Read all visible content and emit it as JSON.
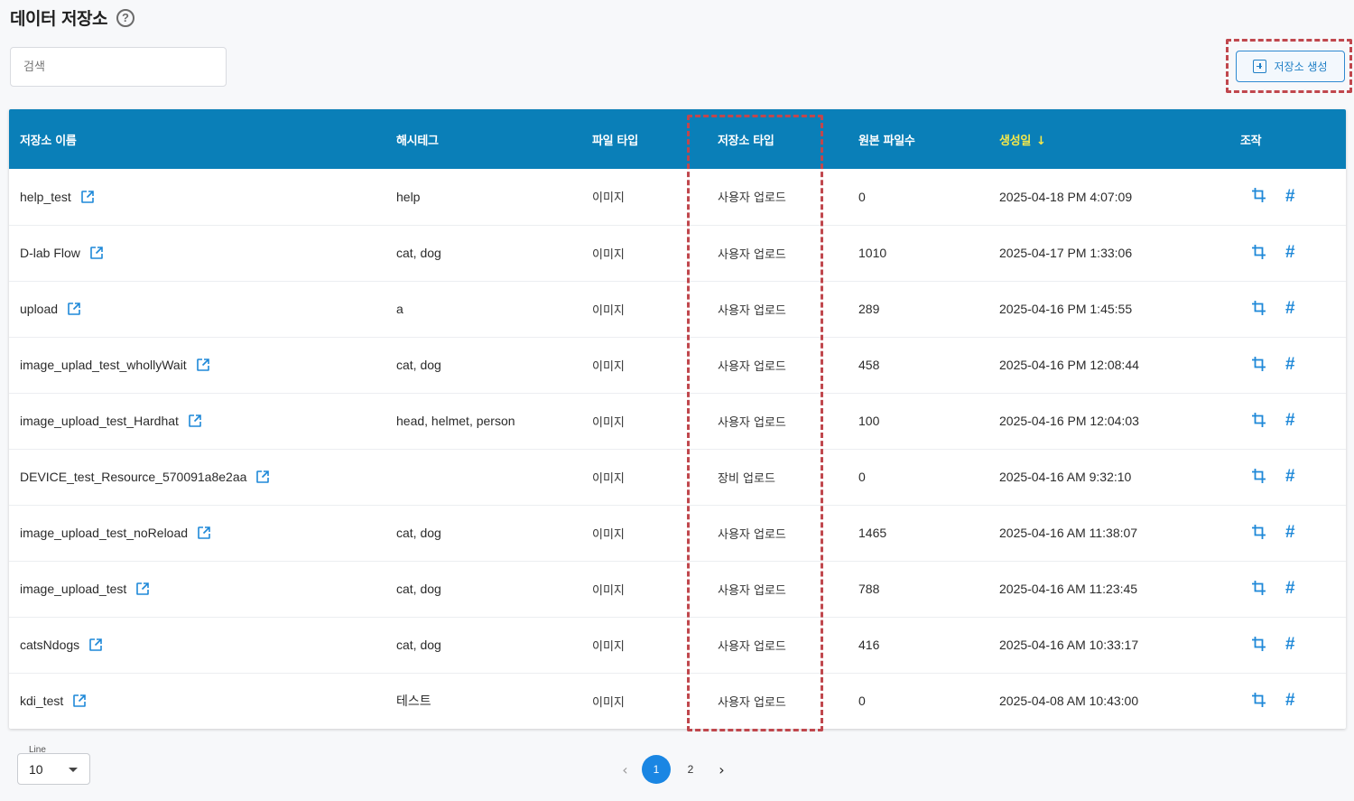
{
  "header": {
    "title": "데이터 저장소",
    "help_icon": "?"
  },
  "search": {
    "placeholder": "검색",
    "value": ""
  },
  "toolbar": {
    "create_label": "저장소 생성"
  },
  "table": {
    "columns": [
      "저장소 이름",
      "해시테그",
      "파일 타입",
      "저장소 타입",
      "원본 파일수",
      "생성일",
      "조작"
    ],
    "sort_indicator": "↓",
    "rows": [
      {
        "name": "help_test",
        "tags": "help",
        "file_type": "이미지",
        "storage_type": "사용자 업로드",
        "count": "0",
        "created": "2025-04-18 PM 4:07:09"
      },
      {
        "name": "D-lab Flow",
        "tags": "cat, dog",
        "file_type": "이미지",
        "storage_type": "사용자 업로드",
        "count": "1010",
        "created": "2025-04-17 PM 1:33:06"
      },
      {
        "name": "upload",
        "tags": "a",
        "file_type": "이미지",
        "storage_type": "사용자 업로드",
        "count": "289",
        "created": "2025-04-16 PM 1:45:55"
      },
      {
        "name": "image_uplad_test_whollyWait",
        "tags": "cat, dog",
        "file_type": "이미지",
        "storage_type": "사용자 업로드",
        "count": "458",
        "created": "2025-04-16 PM 12:08:44"
      },
      {
        "name": "image_upload_test_Hardhat",
        "tags": "head, helmet, person",
        "file_type": "이미지",
        "storage_type": "사용자 업로드",
        "count": "100",
        "created": "2025-04-16 PM 12:04:03"
      },
      {
        "name": "DEVICE_test_Resource_570091a8e2aa",
        "tags": "",
        "file_type": "이미지",
        "storage_type": "장비 업로드",
        "count": "0",
        "created": "2025-04-16 AM 9:32:10"
      },
      {
        "name": "image_upload_test_noReload",
        "tags": "cat, dog",
        "file_type": "이미지",
        "storage_type": "사용자 업로드",
        "count": "1465",
        "created": "2025-04-16 AM 11:38:07"
      },
      {
        "name": "image_upload_test",
        "tags": "cat, dog",
        "file_type": "이미지",
        "storage_type": "사용자 업로드",
        "count": "788",
        "created": "2025-04-16 AM 11:23:45"
      },
      {
        "name": "catsNdogs",
        "tags": "cat, dog",
        "file_type": "이미지",
        "storage_type": "사용자 업로드",
        "count": "416",
        "created": "2025-04-16 AM 10:33:17"
      },
      {
        "name": "kdi_test",
        "tags": "테스트",
        "file_type": "이미지",
        "storage_type": "사용자 업로드",
        "count": "0",
        "created": "2025-04-08 AM 10:43:00"
      }
    ],
    "action_hash_label": "#"
  },
  "pagination": {
    "line_label": "Line",
    "line_value": "10",
    "pages": [
      "1",
      "2"
    ],
    "current": "1"
  },
  "colors": {
    "header_bg": "#0a7fb8",
    "accent": "#1a86e3",
    "sorted_header": "#f5e84a",
    "highlight": "#c0474d"
  },
  "icons": {
    "help": "help-circle-icon",
    "create": "plus-square-icon",
    "row_link": "external-link-icon",
    "action_crop": "crop-icon",
    "action_hash": "hash-icon",
    "prev": "chevron-left-icon",
    "next": "chevron-right-icon",
    "select": "caret-down-icon"
  }
}
